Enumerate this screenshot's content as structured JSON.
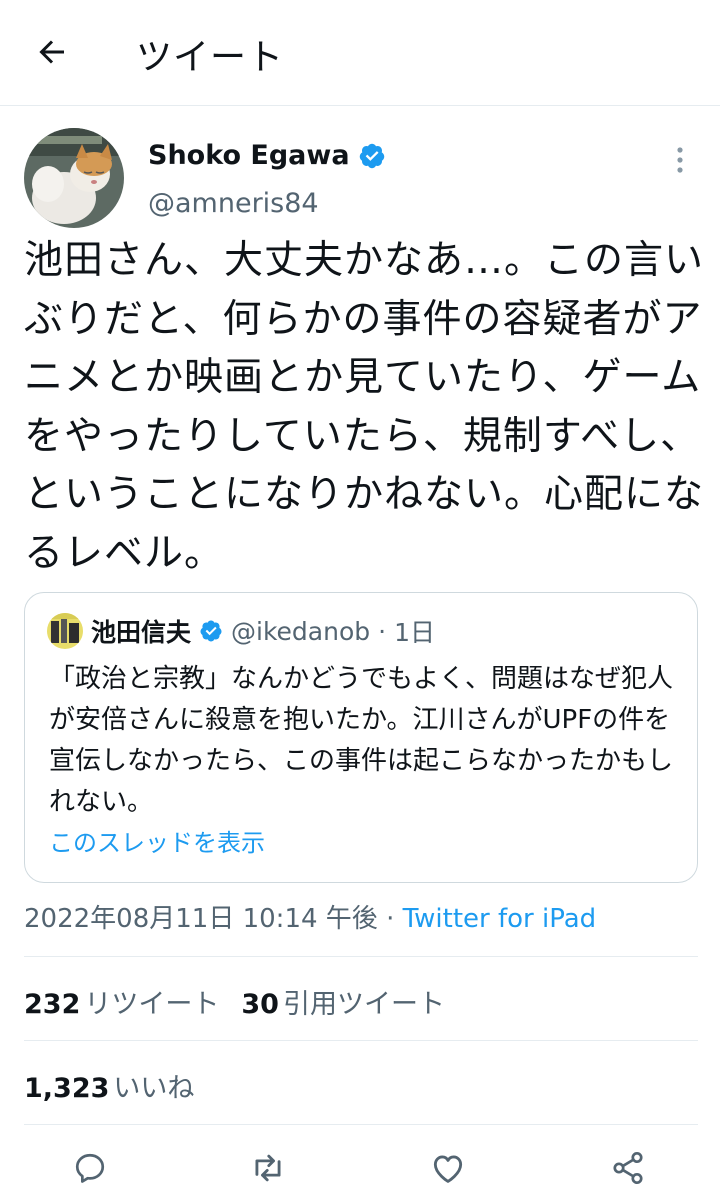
{
  "header": {
    "title": "ツイート",
    "back_icon": "arrow-left-icon"
  },
  "tweet": {
    "author_name": "Shoko Egawa",
    "author_handle": "@amneris84",
    "verified": true,
    "text": "池田さん、大丈夫かなあ…。この言いぶりだと、何らかの事件の容疑者がアニメとか映画とか見ていたり、ゲームをやったりしていたら、規制すべし、ということになりかねない。心配になるレベル。",
    "timestamp": "2022年08月11日 10:14 午後",
    "separator": "·",
    "source": "Twitter for iPad"
  },
  "quote": {
    "author_name": "池田信夫",
    "author_handle": "@ikedanob",
    "separator": "·",
    "age": "1日",
    "text": "「政治と宗教」なんかどうでもよく、問題はなぜ犯人が安倍さんに殺意を抱いたか。江川さんがUPFの件を宣伝しなかったら、この事件は起こらなかったかもしれない。",
    "thread_link": "このスレッドを表示"
  },
  "stats": {
    "retweets": "232",
    "retweets_label": "リツイート",
    "quotes": "30",
    "quotes_label": "引用ツイート",
    "likes": "1,323",
    "likes_label": "いいね"
  },
  "colors": {
    "accent": "#1d9bf0",
    "secondary_text": "#536471",
    "divider": "#e6ecf0"
  }
}
